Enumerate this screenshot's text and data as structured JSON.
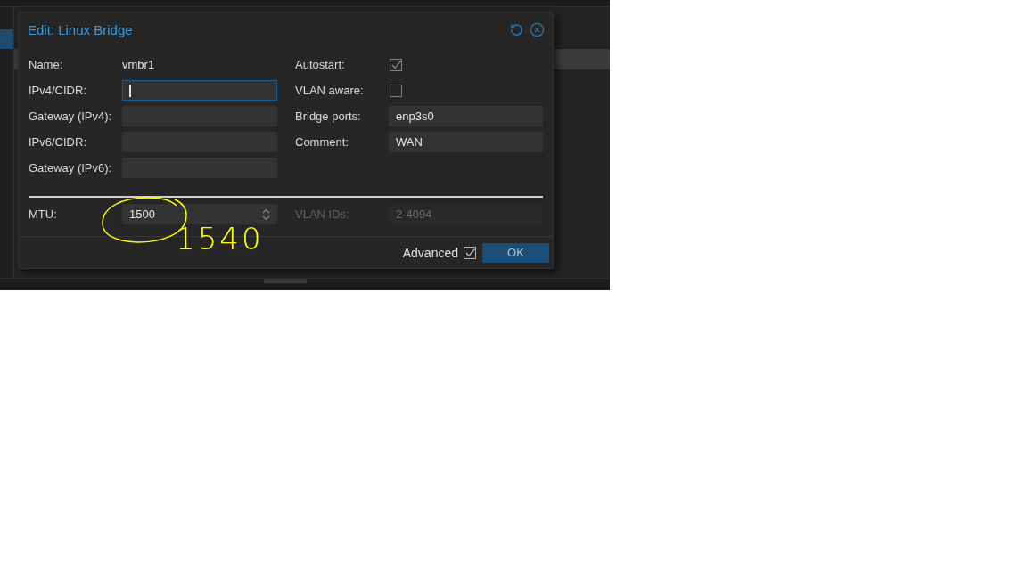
{
  "dialog": {
    "title": "Edit: Linux Bridge",
    "fields_left": [
      {
        "label": "Name:",
        "kind": "display",
        "value": "vmbr1"
      },
      {
        "label": "IPv4/CIDR:",
        "kind": "text",
        "focused": true
      },
      {
        "label": "Gateway (IPv4):",
        "kind": "text",
        "focused": false
      },
      {
        "label": "IPv6/CIDR:",
        "kind": "text",
        "focused": false
      },
      {
        "label": "Gateway (IPv6):",
        "kind": "text",
        "focused": false
      }
    ],
    "fields_right": [
      {
        "label": "Autostart:",
        "kind": "checkbox",
        "checked": true
      },
      {
        "label": "VLAN aware:",
        "kind": "checkbox",
        "checked": false
      },
      {
        "label": "Bridge ports:",
        "kind": "text",
        "value": "enp3s0",
        "focused": false
      },
      {
        "label": "Comment:",
        "kind": "text",
        "value": "WAN",
        "focused": false
      }
    ],
    "advanced_fields_left": [
      {
        "label": "MTU:",
        "kind": "number",
        "value": "1500",
        "focused": false,
        "disabled": false
      }
    ],
    "advanced_fields_right": [
      {
        "label": "VLAN IDs:",
        "kind": "text",
        "placeholder": "2-4094",
        "focused": false,
        "disabled": true
      }
    ],
    "advanced": {
      "label": "Advanced",
      "checked": true
    },
    "buttons": [
      {
        "label": "OK"
      }
    ]
  },
  "annotation": {
    "note": "1540"
  }
}
